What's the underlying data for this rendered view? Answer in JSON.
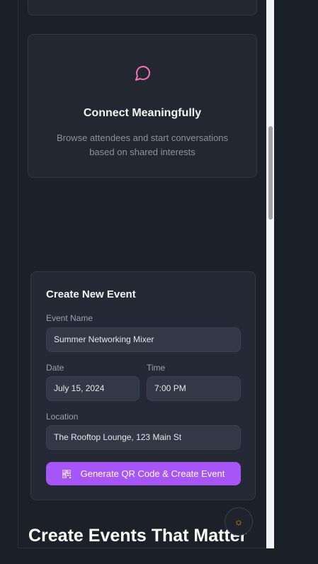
{
  "feature": {
    "title": "Connect Meaningfully",
    "description": "Browse attendees and start conversations based on shared interests",
    "icon": "chat-bubble-icon",
    "icon_color": "#f472b6"
  },
  "event_form": {
    "title": "Create New Event",
    "name_label": "Event Name",
    "name_value": "Summer Networking Mixer",
    "date_label": "Date",
    "date_value": "July 15, 2024",
    "time_label": "Time",
    "time_value": "7:00 PM",
    "location_label": "Location",
    "location_value": "The Rooftop Lounge, 123 Main St",
    "submit_label": "Generate QR Code & Create Event",
    "submit_icon": "qr-code-icon",
    "accent_color": "#a855f7"
  },
  "section": {
    "headline": "Create Events That Matter"
  },
  "theme_toggle": {
    "icon": "sun-icon"
  }
}
